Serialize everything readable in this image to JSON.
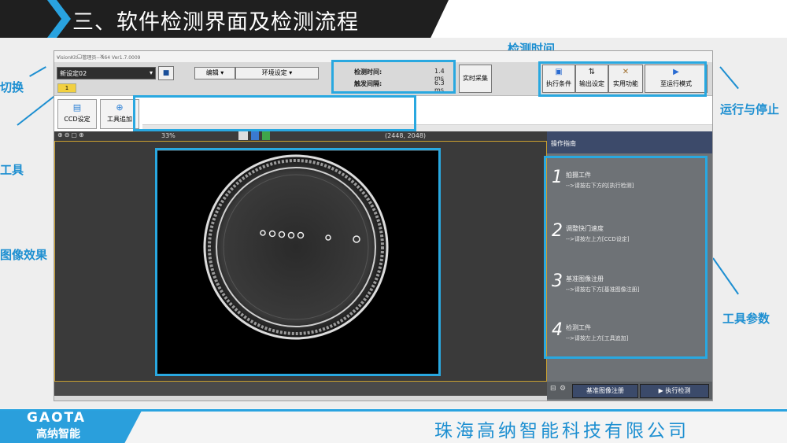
{
  "slide_title": "三、软件检测界面及检测流程",
  "callouts": {
    "switch": "切换",
    "tools": "工具",
    "image_effect": "图像效果",
    "detect_time": "检测时间",
    "run_stop": "运行与停止",
    "tool_params": "工具参数"
  },
  "app": {
    "window_title": "VisionKit---管理员---x64 Ver1.7.0009",
    "window_controls": "–  ▢  ✕",
    "setting_value": "新设定02",
    "badge": "1",
    "menu_edit": "编辑",
    "menu_env": "环境设定",
    "detect_time_label": "检测时间:",
    "detect_time_value": "1.4 ms",
    "trigger_label": "触发间隔:",
    "trigger_value": "6.3 ms",
    "live_capture": "实时采集",
    "buttons": {
      "exec_cond": "执行条件",
      "output_set": "输出设定",
      "utility": "实用功能",
      "run_mode": "至运行模式"
    },
    "tools": {
      "ccd": "CCD设定",
      "add_tool": "工具追加"
    },
    "zoom": "33%",
    "coords": "(2448, 2048)"
  },
  "guide": {
    "header": "操作指南",
    "steps": [
      {
        "num": "1",
        "title": "拍摄工件",
        "desc": "-->请按右下方的[执行检测]"
      },
      {
        "num": "2",
        "title": "调整快门速度",
        "desc": "-->请按左上方[CCD设定]"
      },
      {
        "num": "3",
        "title": "基准图像注册",
        "desc": "-->请按右下方[基准图像注册]"
      },
      {
        "num": "4",
        "title": "检测工件",
        "desc": "-->请按左上方[工具追加]"
      }
    ],
    "register_btn": "基准图像注册",
    "run_btn": "执行检测"
  },
  "footer": {
    "logo": "GAOTA",
    "logo_sub": "高纳智能",
    "company": "珠海高纳智能科技有限公司"
  },
  "colors": {
    "accent": "#29a8e0",
    "dark": "#1f1f1f"
  }
}
